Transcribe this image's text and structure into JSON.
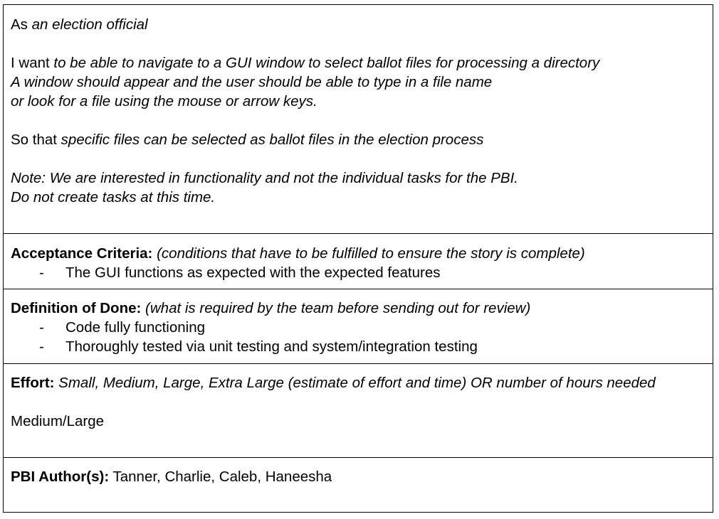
{
  "story": {
    "as_prefix": "As ",
    "as_role": "an election official",
    "want_prefix": "I want ",
    "want_lines": [
      "to be able to navigate to a GUI window to select ballot files for processing a directory",
      "A window should appear and the user should be able to type in a file name",
      "or look for a file using the mouse or arrow keys."
    ],
    "so_prefix": "So that ",
    "so_text": "specific files can be selected as ballot files in the election process",
    "note_lines": [
      "Note:  We are interested in functionality and not the individual tasks for the PBI.",
      "Do not create tasks at this time."
    ]
  },
  "acceptance": {
    "label": "Acceptance Criteria:",
    "desc": " (conditions that have to be fulfilled to ensure the story is complete)",
    "items": [
      "The GUI functions as expected with the expected features"
    ]
  },
  "dod": {
    "label": "Definition of Done:",
    "desc": " (what is required by the team before sending out for review)",
    "items": [
      "Code fully functioning",
      "Thoroughly tested via unit testing and system/integration testing"
    ]
  },
  "effort": {
    "label": "Effort:",
    "desc": "  Small, Medium, Large, Extra Large (estimate of effort and time) OR number of hours needed",
    "value": "Medium/Large"
  },
  "author": {
    "label": "PBI Author(s):",
    "names": " Tanner, Charlie, Caleb, Haneesha"
  },
  "bullet_char": "-"
}
